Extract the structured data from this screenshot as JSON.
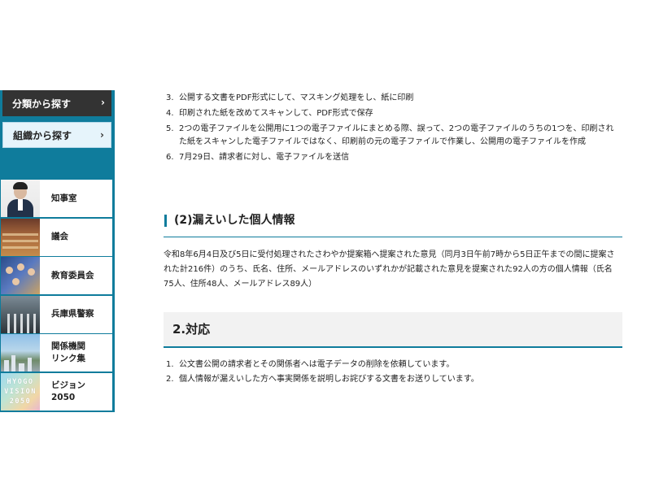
{
  "sidebar": {
    "nav": [
      {
        "label": "分類から探す",
        "chevron": "›"
      },
      {
        "label": "組織から探す",
        "chevron": "›"
      }
    ],
    "links": [
      {
        "label": "知事室",
        "thumb": "governor-photo"
      },
      {
        "label": "議会",
        "thumb": "assembly-hall-photo"
      },
      {
        "label": "教育委員会",
        "thumb": "students-photo"
      },
      {
        "label": "兵庫県警察",
        "thumb": "police-building-photo"
      },
      {
        "label": "関係機関\nリンク集",
        "thumb": "city-view-photo"
      },
      {
        "label": "ビジョン\n2050",
        "thumb": "hyogo-vision-logo",
        "thumb_text": [
          "HYOGO",
          "VISION",
          "2050"
        ]
      }
    ],
    "accent_color": "#0f7c9c"
  },
  "main": {
    "steps": [
      {
        "num": "3.",
        "text": "公開する文書をPDF形式にして、マスキング処理をし、紙に印刷"
      },
      {
        "num": "4.",
        "text": "印刷された紙を改めてスキャンして、PDF形式で保存"
      },
      {
        "num": "5.",
        "text": "2つの電子ファイルを公開用に1つの電子ファイルにまとめる際、誤って、2つの電子ファイルのうちの1つを、印刷された紙をスキャンした電子ファイルではなく、印刷前の元の電子ファイルで作業し、公開用の電子ファイルを作成"
      },
      {
        "num": "6.",
        "text": "7月29日、請求者に対し、電子ファイルを送信"
      }
    ],
    "section_heading": "(2)漏えいした個人情報",
    "paragraph": "令和8年6月4日及び5日に受付処理されたさわやか提案箱へ提案された意見（同月3日午前7時から5日正午までの間に提案された計216件）のうち、氏名、住所、メールアドレスのいずれかが記載された意見を提案された92人の方の個人情報（氏名75人、住所48人、メールアドレス89人）",
    "heading2": "2.対応",
    "actions": [
      {
        "num": "1.",
        "text": "公文書公開の請求者とその関係者へは電子データの削除を依頼しています。"
      },
      {
        "num": "2.",
        "text": "個人情報が漏えいした方へ事実関係を説明しお詫びする文書をお送りしています。"
      }
    ]
  }
}
